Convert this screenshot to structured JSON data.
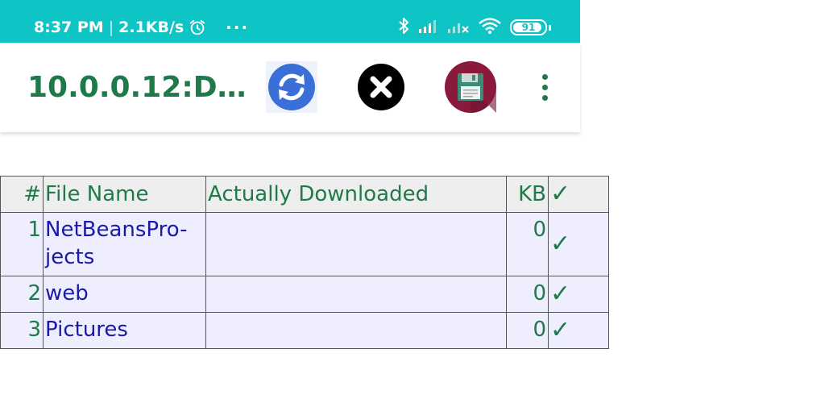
{
  "status_bar": {
    "time": "8:37 PM",
    "speed": "2.1KB/s",
    "overflow": "···",
    "battery": "91",
    "battery_level": 0.91,
    "icons": [
      "alarm-icon",
      "bluetooth-icon",
      "signal-icon",
      "signal-no-service-icon",
      "wifi-icon",
      "battery-icon"
    ],
    "background_color": "#0fc4c4"
  },
  "app_bar": {
    "title": "10.0.0.12:D…",
    "title_color": "#1f7a4a",
    "actions": [
      "refresh-icon",
      "close-icon",
      "save-icon",
      "more-vert-icon"
    ]
  },
  "table": {
    "headers": {
      "num": "#",
      "name": "File Name",
      "downloaded": "Actually Downloaded",
      "kb": "KB",
      "check": "✓"
    },
    "rows": [
      {
        "num": "1",
        "name": "NetBeansPro-jects",
        "downloaded": "",
        "kb": "0",
        "check": "✓"
      },
      {
        "num": "2",
        "name": "web",
        "downloaded": "",
        "kb": "0",
        "check": "✓"
      },
      {
        "num": "3",
        "name": "Pictures",
        "downloaded": "",
        "kb": "0",
        "check": "✓"
      }
    ],
    "header_color": "#1f7a4a",
    "link_color": "#1a1aaa",
    "row_bg": "#eeeeff"
  }
}
